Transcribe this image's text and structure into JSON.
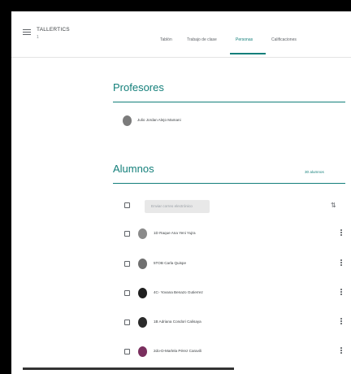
{
  "header": {
    "app_title": "TALLERTICS",
    "app_subtitle": "1",
    "tabs": [
      {
        "label": "Tablón",
        "active": false
      },
      {
        "label": "Trabajo de clase",
        "active": false
      },
      {
        "label": "Personas",
        "active": true
      },
      {
        "label": "Calificaciones",
        "active": false
      }
    ]
  },
  "teachers": {
    "title": "Profesores",
    "list": [
      {
        "name": "Julio Jordan Alejo Mamani",
        "avatar_color": "#7b7b7b"
      }
    ]
  },
  "students": {
    "title": "Alumnos",
    "count_label": "30 alumnos",
    "email_button_label": "Enviar correo electrónico",
    "list": [
      {
        "name": "1D Raque Ana Yeni Yujra",
        "avatar_color": "#8a8a8a"
      },
      {
        "name": "5TOB Carla Quispe",
        "avatar_color": "#6f6f6f"
      },
      {
        "name": "4C- Yovana Benazo Gutierrez",
        "avatar_color": "#1f1f1f"
      },
      {
        "name": "1B Adriana Condori Calisaya",
        "avatar_color": "#2a2a2a"
      },
      {
        "name": "2do-D-Marlela Pérez Caravili",
        "avatar_color": "#7a2f5e"
      }
    ]
  },
  "colors": {
    "accent": "#137f7a",
    "text": "#3c4043",
    "muted": "#5f6368"
  },
  "icons": {
    "menu": "hamburger-icon",
    "sort": "sort-az-icon",
    "more": "more-vert-icon"
  }
}
